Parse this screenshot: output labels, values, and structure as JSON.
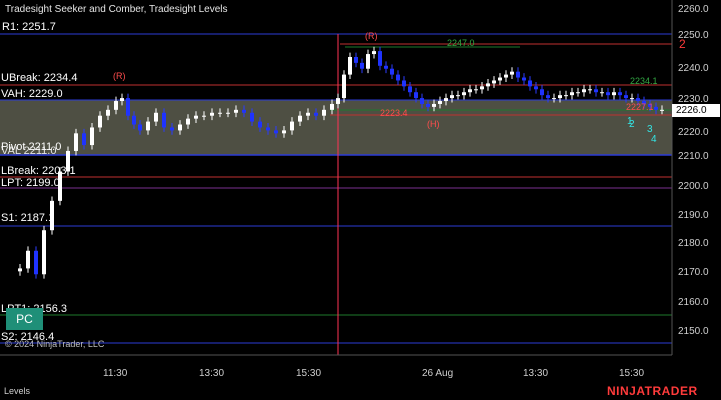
{
  "title": "Tradesight Seeker and Comber, Tradesight Levels",
  "levels": {
    "r1": "R1: 2251.7",
    "ubreak": "UBreak: 2234.4",
    "vah": "VAH: 2229.0",
    "pivot": "Pivot 2211.0",
    "val": "VAL 2211.0",
    "lbreak": "LBreak: 2203.1",
    "lpt": "LPT: 2199.0",
    "s1": "S1: 2187.1",
    "lpt2": "LPT1: 2156.3",
    "s2": "S2: 2146.4"
  },
  "y_axis_ticks": [
    "2260.0",
    "2250.0",
    "2240.0",
    "2230.0",
    "2220.0",
    "2210.0",
    "2200.0",
    "2190.0",
    "2180.0",
    "2170.0",
    "2160.0",
    "2150.0"
  ],
  "current_price": "2226.0",
  "x_axis_ticks": [
    "11:30",
    "13:30",
    "15:30",
    "26 Aug",
    "13:30",
    "15:30"
  ],
  "annotations": {
    "r_marker_1": "(R)",
    "r_marker_2": "(R)",
    "h_marker": "(H)",
    "level_2247": "2247.0",
    "level_2223": "2223.4",
    "level_2234": "2234.1",
    "level_2227": "2227.1",
    "red_2": "2",
    "cyan_1": "1",
    "cyan_2": "2",
    "cyan_3": "3",
    "cyan_4": "4"
  },
  "pc_button": "PC",
  "copyright": "© 2024 NinjaTrader, LLC",
  "footer_left": "Levels",
  "brand": "NINJATRADER",
  "colors": {
    "background": "#000000",
    "value_area": "#56584a",
    "r_line": "#2b3bd6",
    "break_line": "#c0302f",
    "support_line": "#2b3bd6",
    "lpt_line": "#7a2f8f",
    "green_line": "#1e7a2c",
    "up_candle": "#ffffff",
    "down_candle": "#1f33ff",
    "session_divider": "#ff3355"
  }
}
